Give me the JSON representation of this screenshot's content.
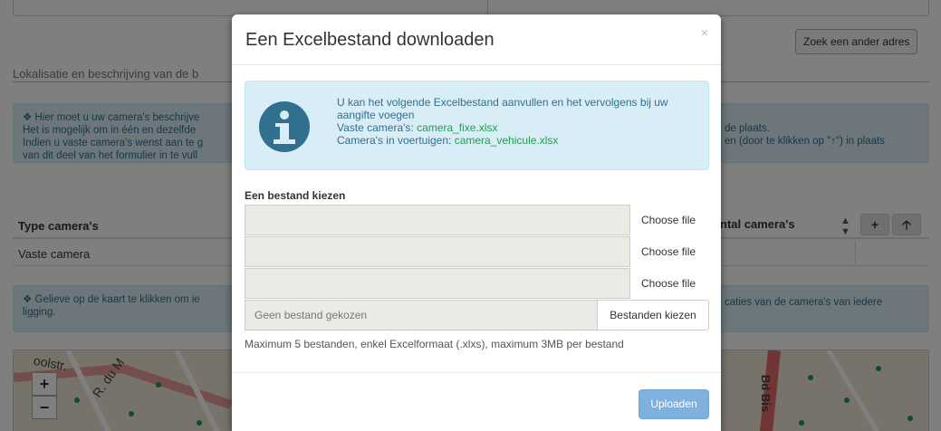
{
  "background": {
    "search_button": "Zoek een ander adres",
    "section_title": "Lokalisatie en beschrijving van de b",
    "alert1": {
      "line1": "Hier moet u uw camera's beschrijve",
      "line2": "Het is mogelijk om in één en dezelfde",
      "line3": "Indien u vaste camera's wenst aan te g",
      "line4": "van dit deel van het formulier in te vull",
      "right_line1": "de plaats.",
      "right_line2": "en (door te klikken op \"↑\") in plaats"
    },
    "table": {
      "col1_header": "Type camera's",
      "col2_header": "ntal camera's",
      "row1_col1": "Vaste camera",
      "add_icon": "plus-icon",
      "up_icon": "arrow-up-icon"
    },
    "alert2": {
      "line1": "Gelieve op de kaart te klikken om ie",
      "line2": "ligging.",
      "right_line1": "caties van de camera's van iedere"
    },
    "map": {
      "street1": "oolstr.",
      "street2": "R. du M",
      "street3": "Bd Bis",
      "zoom_in": "+",
      "zoom_out": "−"
    }
  },
  "modal": {
    "title": "Een Excelbestand downloaden",
    "close_label": "×",
    "info": {
      "line1": "U kan het volgende Excelbestand aanvullen en het vervolgens bij uw",
      "line2": "aangifte voegen",
      "fixed_prefix": "Vaste camera's: ",
      "fixed_link": "camera_fixe.xlsx",
      "vehicle_prefix": "Camera's in voertuigen: ",
      "vehicle_link": "camera_vehicule.xlsx",
      "icon": "info-icon"
    },
    "file_section_label": "Een bestand kiezen",
    "file_inputs": [
      {
        "value": "",
        "button": "Choose file"
      },
      {
        "value": "",
        "button": "Choose file"
      },
      {
        "value": "",
        "button": "Choose file"
      }
    ],
    "multi_input": {
      "placeholder": "Geen bestand gekozen",
      "button": "Bestanden kiezen"
    },
    "help_text": "Maximum 5 bestanden, enkel Excelformaat (.xlxs), maximum 3MB per bestand",
    "upload_button": "Uploaden"
  },
  "colors": {
    "info_bg": "#d9edf7",
    "info_text": "#31708f",
    "link_green": "#1aa24b",
    "primary_disabled": "#7fb1de"
  }
}
